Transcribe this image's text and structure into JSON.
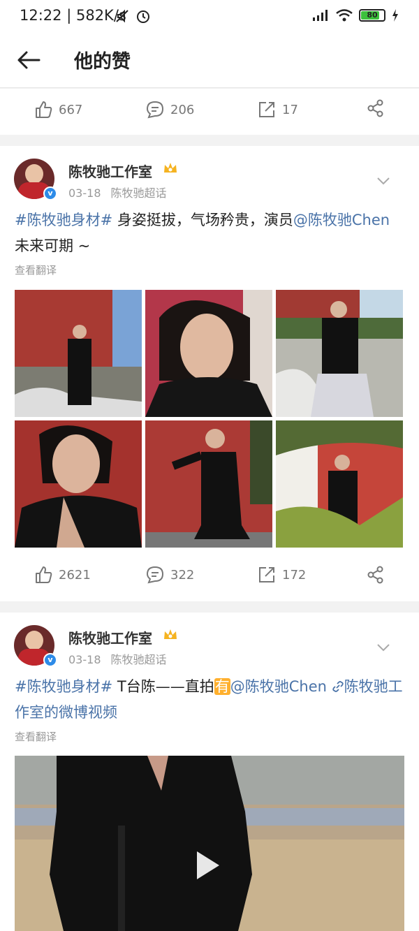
{
  "status_bar": {
    "time": "12:22",
    "speed": "582K/s",
    "battery": "80"
  },
  "header": {
    "title": "他的赞"
  },
  "top_actions": {
    "likes": "667",
    "comments": "206",
    "reposts": "17"
  },
  "posts": [
    {
      "author": "陈牧驰工作室",
      "date": "03-18",
      "source": "陈牧驰超话",
      "text_hashtag": "#陈牧驰身材#",
      "text_body": " 身姿挺拔，气场矜贵，演员",
      "text_mention": "@陈牧驰Chen",
      "text_tail": " 未来可期 ~",
      "translate": "查看翻译",
      "likes": "2621",
      "comments": "322",
      "reposts": "172"
    },
    {
      "author": "陈牧驰工作室",
      "date": "03-18",
      "source": "陈牧驰超话",
      "text_hashtag": "#陈牧驰身材#",
      "text_body": " T台陈——直拍",
      "text_you": "有",
      "text_mention": "@陈牧驰Chen",
      "text_link": "陈牧驰工作室的微博视频",
      "translate": "查看翻译"
    }
  ],
  "colors": {
    "link": "#4a73a8",
    "accent_orange": "#ffb02e",
    "verified_blue": "#2d8be8"
  }
}
